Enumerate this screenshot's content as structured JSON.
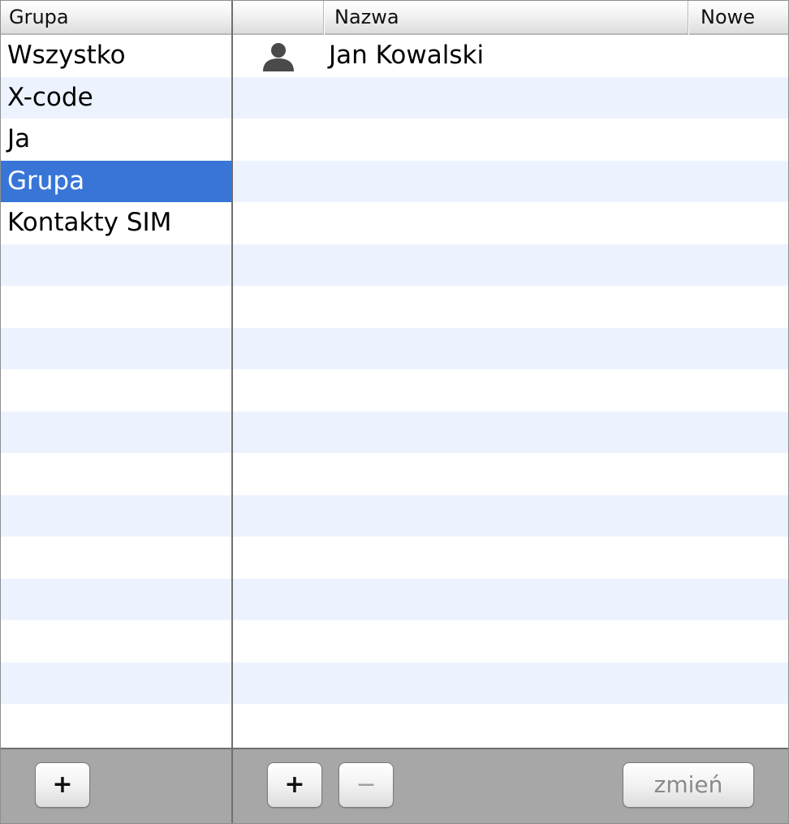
{
  "groups_pane": {
    "header": "Grupa",
    "items": [
      {
        "label": "Wszystko",
        "selected": false
      },
      {
        "label": "X-code",
        "selected": false
      },
      {
        "label": "Ja",
        "selected": false
      },
      {
        "label": "Grupa",
        "selected": true
      },
      {
        "label": "Kontakty SIM",
        "selected": false
      }
    ],
    "add_button": "+"
  },
  "contacts_pane": {
    "headers": {
      "icon": "",
      "name": "Nazwa",
      "new": "Nowe"
    },
    "contacts": [
      {
        "name": "Jan Kowalski",
        "icon": "person-icon"
      }
    ],
    "add_button": "+",
    "remove_button": "−",
    "edit_button": "zmień"
  },
  "colors": {
    "selection": "#3875d7",
    "alt_row": "#edf3fe",
    "toolbar": "#a7a7a7"
  }
}
